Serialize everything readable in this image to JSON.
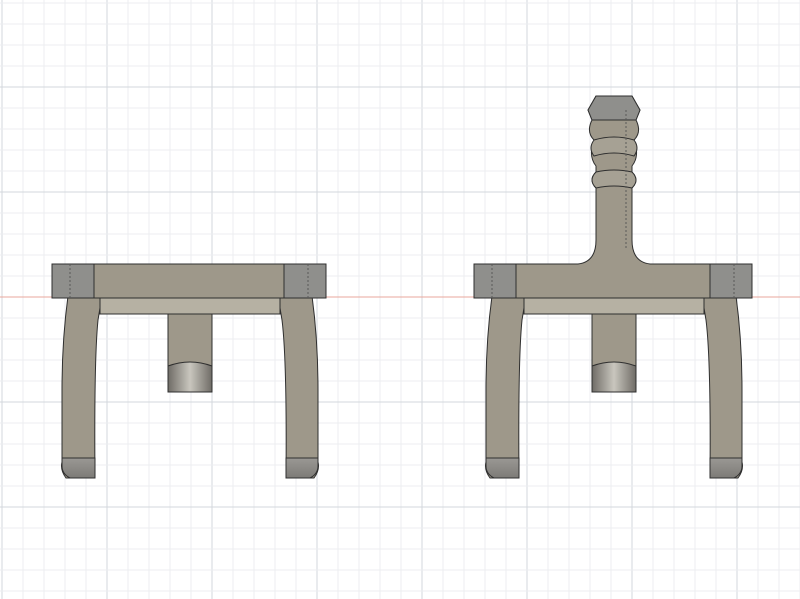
{
  "viewport": {
    "background": "#ffffff",
    "grid_minor_color": "#eceef1",
    "grid_major_color": "#d3d7dc",
    "axis_color": "#e9a79c"
  },
  "model": {
    "body_color": "#9e988a",
    "end_block_color": "#8f8f8c",
    "underside_color": "#b6b1a3",
    "edge_color": "#2f2f2f"
  },
  "views": [
    {
      "id": "left-view",
      "variant": "without-spindle"
    },
    {
      "id": "right-view",
      "variant": "with-spindle"
    }
  ]
}
